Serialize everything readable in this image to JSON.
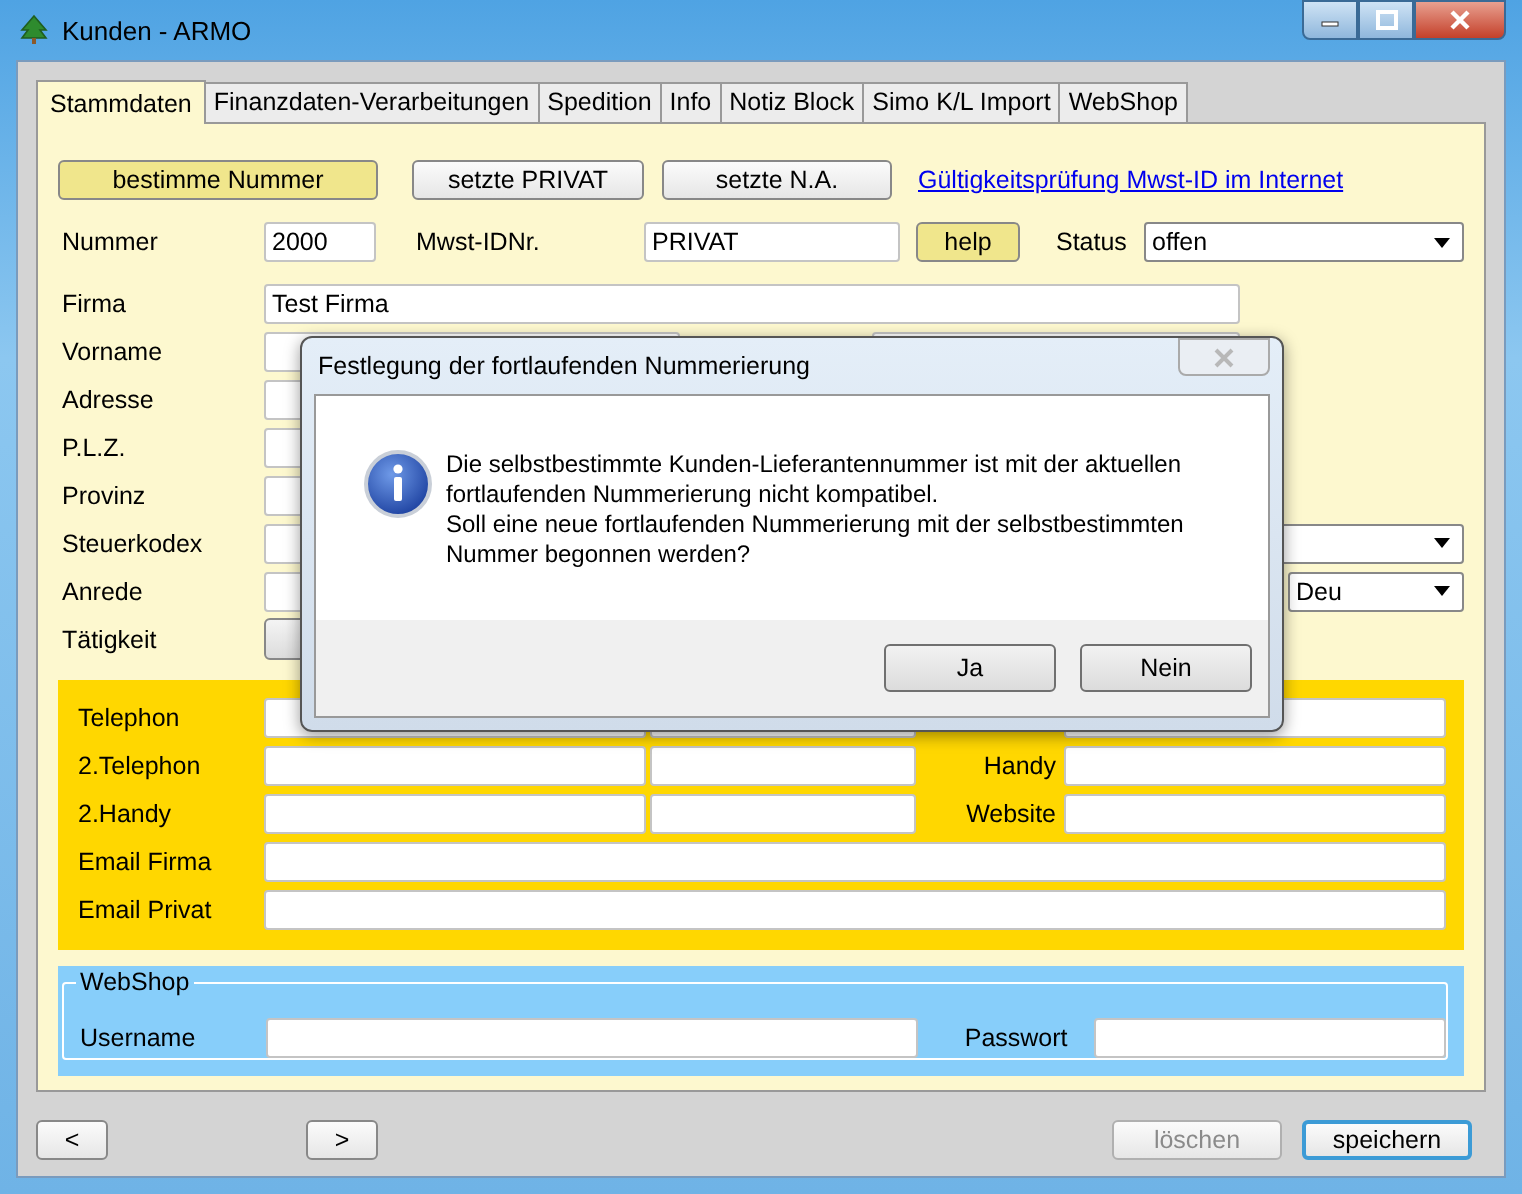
{
  "window": {
    "title": "Kunden - ARMO"
  },
  "tabs": [
    {
      "label": "Stammdaten",
      "selected": true
    },
    {
      "label": "Finanzdaten-Verarbeitungen",
      "selected": false
    },
    {
      "label": "Spedition",
      "selected": false
    },
    {
      "label": "Info",
      "selected": false
    },
    {
      "label": "Notiz Block",
      "selected": false
    },
    {
      "label": "Simo K/L Import",
      "selected": false
    },
    {
      "label": "WebShop",
      "selected": false
    }
  ],
  "top_buttons": [
    {
      "label": "bestimme Nummer",
      "highlighted": true
    },
    {
      "label": "setzte PRIVAT",
      "highlighted": false
    },
    {
      "label": "setzte N.A.",
      "highlighted": false
    }
  ],
  "link": "Gültigkeitsprüfung Mwst-ID im Internet",
  "id_row": {
    "nummer_label": "Nummer",
    "nummer_value": "2000",
    "mwst_label": "Mwst-IDNr.",
    "mwst_value": "PRIVAT",
    "help_button": "help",
    "status_label": "Status",
    "status_value": "offen"
  },
  "form_rows": [
    {
      "label": "Firma",
      "kind": "wide",
      "value": "Test Firma"
    },
    {
      "label": "Vorname",
      "kind": "double"
    },
    {
      "label": "Adresse",
      "kind": "single"
    },
    {
      "label": "P.L.Z.",
      "kind": "single"
    },
    {
      "label": "Provinz",
      "kind": "single"
    },
    {
      "label": "Steuerkodex",
      "kind": "select"
    },
    {
      "label": "Anrede",
      "kind": "language",
      "value": "Deu"
    },
    {
      "label": "Tätigkeit",
      "kind": "button"
    }
  ],
  "contact_rows": [
    {
      "label": "Telephon",
      "kind": "triple"
    },
    {
      "label": "2.Telephon",
      "kind": "triple",
      "side_label": "Handy"
    },
    {
      "label": "2.Handy",
      "kind": "triple",
      "side_label": "Website"
    },
    {
      "label": "Email Firma",
      "kind": "wide"
    },
    {
      "label": "Email Privat",
      "kind": "wide"
    }
  ],
  "webshop": {
    "legend": "WebShop",
    "username_label": "Username",
    "password_label": "Passwort"
  },
  "bottom_buttons": [
    {
      "label": "<",
      "kind": "nav",
      "disabled": false,
      "default": false
    },
    {
      "label": ">",
      "kind": "nav",
      "disabled": false,
      "default": false
    },
    {
      "label": "löschen",
      "kind": "action",
      "disabled": true,
      "default": false
    },
    {
      "label": "speichern",
      "kind": "action",
      "disabled": false,
      "default": true
    }
  ],
  "dialog": {
    "title": "Festlegung der fortlaufenden Nummerierung",
    "paragraphs": [
      "Die selbstbestimmte Kunden-Lieferantennummer ist mit der aktuellen fortlaufenden Nummerierung nicht kompatibel.",
      "Soll eine neue fortlaufenden Nummerierung mit der selbstbestimmten Nummer begonnen werden?"
    ],
    "buttons": [
      "Ja",
      "Nein"
    ]
  }
}
